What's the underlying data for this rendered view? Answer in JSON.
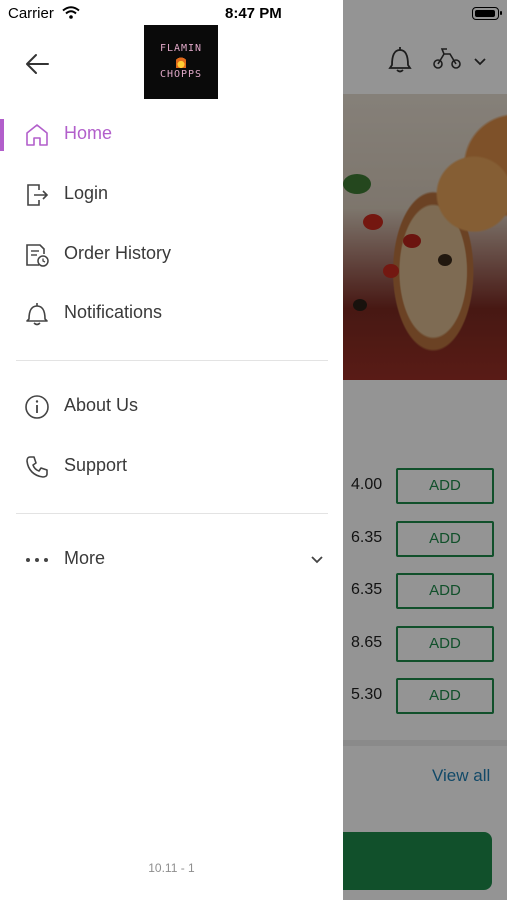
{
  "status_bar": {
    "carrier": "Carrier",
    "time": "8:47 PM"
  },
  "drawer": {
    "logo_line1": "FLAMIN",
    "logo_line2": "CHOPPS",
    "menu": [
      {
        "label": "Home",
        "icon": "home-icon",
        "active": true
      },
      {
        "label": "Login",
        "icon": "login-icon",
        "active": false
      },
      {
        "label": "Order History",
        "icon": "order-history-icon",
        "active": false
      },
      {
        "label": "Notifications",
        "icon": "bell-icon",
        "active": false
      }
    ],
    "secondary_menu": [
      {
        "label": "About Us",
        "icon": "info-icon"
      },
      {
        "label": "Support",
        "icon": "phone-icon"
      }
    ],
    "more": {
      "label": "More",
      "icon": "more-dots-icon"
    },
    "version": "10.11 - 1"
  },
  "background": {
    "prices": [
      "4.00",
      "6.35",
      "6.35",
      "8.65",
      "5.30"
    ],
    "add_label": "ADD",
    "view_all": "View all"
  },
  "colors": {
    "accent": "#b25fcb",
    "green": "#1e8a4a",
    "link": "#1f7fb3"
  }
}
